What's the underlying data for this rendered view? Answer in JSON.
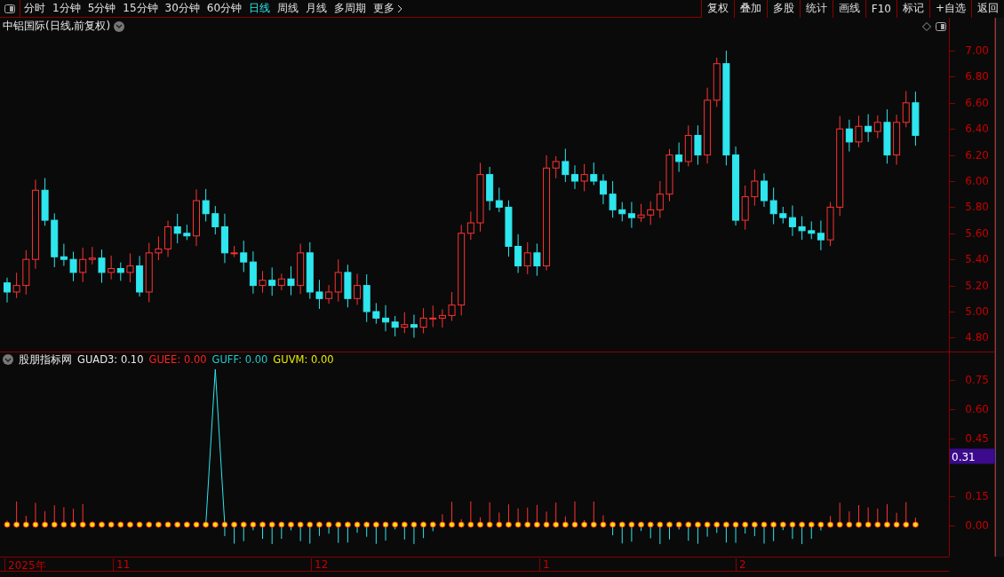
{
  "toolbar": {
    "periods": [
      {
        "label": "分时",
        "selected": false
      },
      {
        "label": "1分钟",
        "selected": false
      },
      {
        "label": "5分钟",
        "selected": false
      },
      {
        "label": "15分钟",
        "selected": false
      },
      {
        "label": "30分钟",
        "selected": false
      },
      {
        "label": "60分钟",
        "selected": false
      },
      {
        "label": "日线",
        "selected": true
      },
      {
        "label": "周线",
        "selected": false
      },
      {
        "label": "月线",
        "selected": false
      },
      {
        "label": "多周期",
        "selected": false
      },
      {
        "label": "更多",
        "selected": false
      }
    ],
    "actions": [
      "复权",
      "叠加",
      "多股",
      "统计",
      "画线",
      "F10",
      "标记",
      "+自选",
      "返回"
    ]
  },
  "main_chart": {
    "title": "中铝国际(日线,前复权)",
    "y_ticks": [
      "7.00",
      "6.80",
      "6.60",
      "6.40",
      "6.20",
      "6.00",
      "5.80",
      "5.60",
      "5.40",
      "5.20",
      "5.00",
      "4.80"
    ]
  },
  "indicator": {
    "name": "股朋指标网",
    "values": [
      {
        "label": "GUAD3: 0.10",
        "color": "#e8e8e8"
      },
      {
        "label": "GUEE: 0.00",
        "color": "#ff2020"
      },
      {
        "label": "GUFF: 0.00",
        "color": "#20c8c8"
      },
      {
        "label": "GUVM: 0.00",
        "color": "#e8e800"
      }
    ],
    "y_ticks": [
      "0.75",
      "0.60",
      "0.45",
      "0.15",
      "0.00"
    ],
    "cursor_value": "0.31"
  },
  "time_axis": [
    "2025年",
    "11",
    "12",
    "1",
    "2"
  ]
}
